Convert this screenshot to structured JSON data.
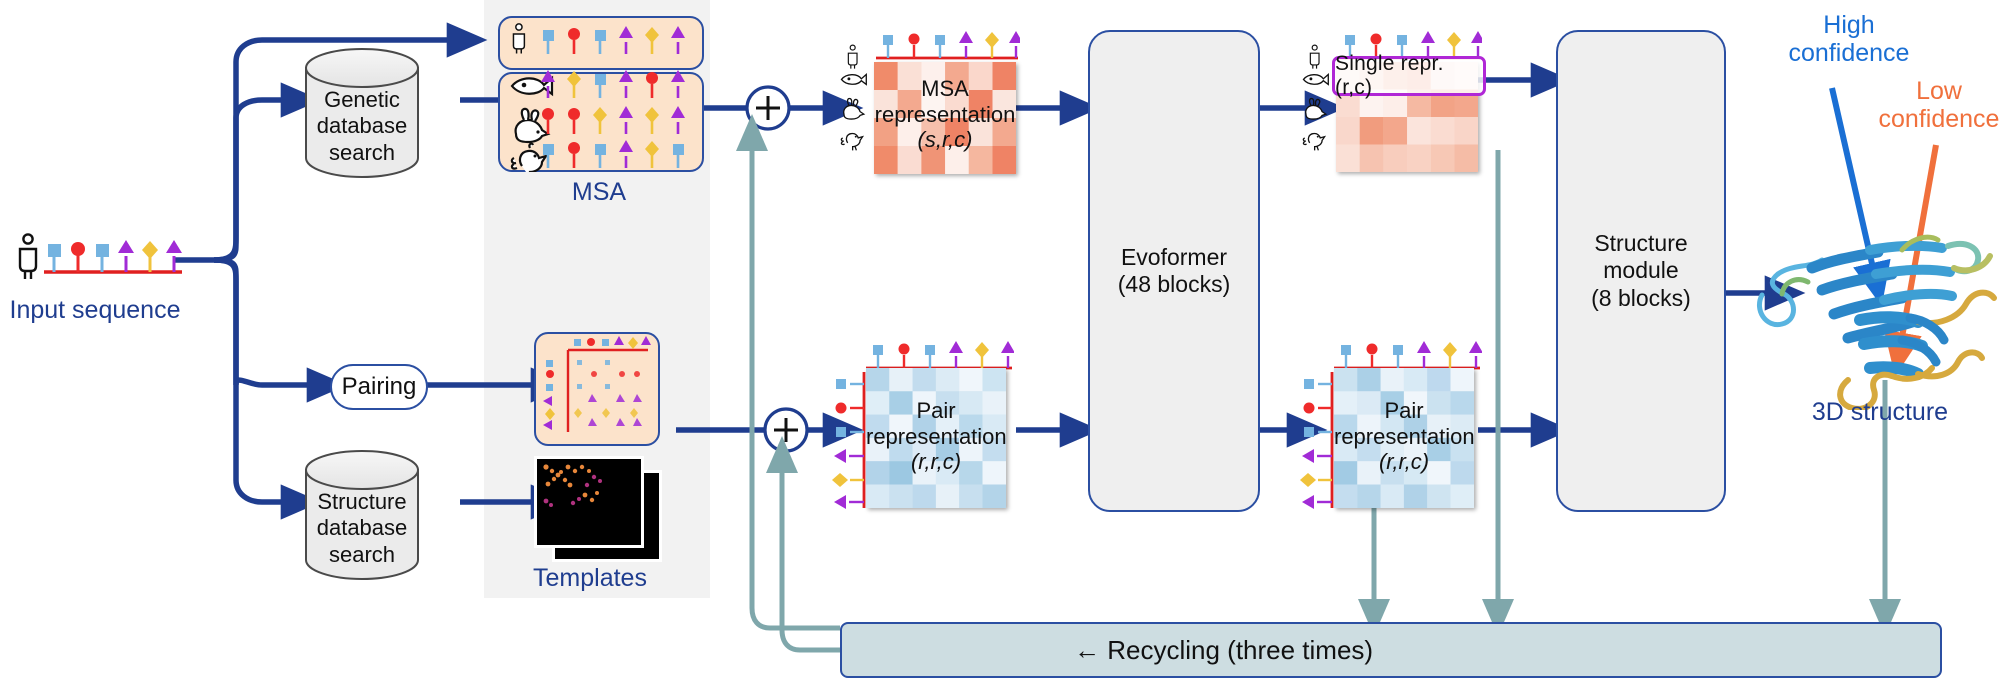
{
  "diagram": {
    "title": "AlphaFold 2 architecture",
    "colors": {
      "arrow_blue": "#1f3d8f",
      "label_blue": "#1f3d8f",
      "recycle_teal": "#7fa7ab",
      "msa_panel_bg": "#fce3cb",
      "group_border": "#2b4fa2",
      "grey_panel": "#f2f2f2",
      "block_fill": "#efefef",
      "highlight_purple": "#b027d6",
      "high_conf": "#1a6fd4",
      "low_conf": "#f0703c",
      "residue_blue": "#74b3e0",
      "residue_red": "#ef2b2b",
      "residue_purple": "#a12bd6",
      "residue_gold": "#f0c33c",
      "sequence_line": "#e02020"
    },
    "input": {
      "label": "Input sequence"
    },
    "searches": {
      "genetic": "Genetic\ndatabase\nsearch",
      "genetic_lines": [
        "Genetic",
        "database",
        "search"
      ],
      "structure_lines": [
        "Structure",
        "database",
        "search"
      ],
      "pairing": "Pairing"
    },
    "msa": {
      "label": "MSA"
    },
    "templates": {
      "label": "Templates"
    },
    "msa_representation": {
      "lines": [
        "MSA",
        "representation",
        "(s,r,c)"
      ]
    },
    "pair_representation": {
      "lines": [
        "Pair",
        "representation",
        "(r,r,c)"
      ]
    },
    "pair_representation_2": {
      "lines": [
        "Pair",
        "representation",
        "(r,r,c)"
      ]
    },
    "single_representation": {
      "label": "Single repr. (r,c)"
    },
    "evoformer": {
      "lines": [
        "Evoformer",
        "(48 blocks)"
      ]
    },
    "structure_module": {
      "lines": [
        "Structure",
        "module",
        "(8 blocks)"
      ]
    },
    "recycling": {
      "label": "← Recycling (three times)"
    },
    "output": {
      "label": "3D structure",
      "high_confidence": "High\nconfidence",
      "high_confidence_lines": [
        "High",
        "confidence"
      ],
      "low_confidence_lines": [
        "Low",
        "confidence"
      ]
    },
    "sequence_glyphs": [
      "square-blue",
      "circle-red",
      "square-blue",
      "arrow-purple",
      "diamond-gold",
      "arrow-purple"
    ],
    "msa_rows": [
      {
        "organism": "human-icon",
        "glyphs": [
          "square-blue",
          "circle-red",
          "square-blue",
          "arrow-purple",
          "diamond-gold",
          "arrow-purple"
        ]
      },
      {
        "organism": "fish-icon",
        "glyphs": [
          "arrow-purple",
          "diamond-gold",
          "square-blue",
          "arrow-purple",
          "circle-red",
          "arrow-purple"
        ]
      },
      {
        "organism": "rabbit-icon",
        "glyphs": [
          "circle-red",
          "circle-red",
          "diamond-gold",
          "arrow-purple",
          "diamond-gold",
          "arrow-purple"
        ]
      },
      {
        "organism": "chicken-icon",
        "glyphs": [
          "square-blue",
          "circle-red",
          "square-blue",
          "arrow-purple",
          "diamond-gold",
          "square-blue"
        ]
      }
    ],
    "msa_rep_rows": [
      "human-icon",
      "fish-icon",
      "rabbit-icon",
      "chicken-icon"
    ],
    "single_rep_rows": [
      "human-icon",
      "fish-icon",
      "rabbit-icon",
      "chicken-icon"
    ]
  },
  "chart_data": {
    "type": "heatmap",
    "title": "AlphaFold 2 network architecture",
    "panels": [
      {
        "name": "MSA representation (s,r,c)",
        "colormap": "reds",
        "cols": 6,
        "rows": 4,
        "values": [
          [
            0.55,
            0.3,
            0.15,
            0.45,
            0.25,
            0.5
          ],
          [
            0.2,
            0.45,
            0.12,
            0.3,
            0.55,
            0.18
          ],
          [
            0.42,
            0.18,
            0.35,
            0.55,
            0.2,
            0.4
          ],
          [
            0.5,
            0.22,
            0.48,
            0.15,
            0.38,
            0.55
          ]
        ]
      },
      {
        "name": "Single repr. (r,c)",
        "colormap": "reds",
        "cols": 6,
        "rows": 4,
        "values": [
          [
            0.18,
            0.3,
            0.45,
            0.52,
            0.22,
            0.16
          ],
          [
            0.22,
            0.1,
            0.14,
            0.4,
            0.48,
            0.46
          ],
          [
            0.26,
            0.52,
            0.46,
            0.18,
            0.22,
            0.24
          ],
          [
            0.2,
            0.34,
            0.28,
            0.25,
            0.3,
            0.35
          ]
        ]
      },
      {
        "name": "Pair representation (r,r,c)",
        "colormap": "blues",
        "cols": 6,
        "rows": 6,
        "values": [
          [
            0.42,
            0.18,
            0.38,
            0.22,
            0.1,
            0.3
          ],
          [
            0.2,
            0.46,
            0.14,
            0.34,
            0.26,
            0.16
          ],
          [
            0.35,
            0.12,
            0.44,
            0.18,
            0.4,
            0.24
          ],
          [
            0.16,
            0.38,
            0.22,
            0.48,
            0.14,
            0.36
          ],
          [
            0.46,
            0.52,
            0.18,
            0.26,
            0.42,
            0.12
          ],
          [
            0.22,
            0.3,
            0.4,
            0.16,
            0.34,
            0.44
          ]
        ]
      },
      {
        "name": "Pair representation (r,r,c) second",
        "colormap": "blues",
        "cols": 6,
        "rows": 6,
        "values": [
          [
            0.3,
            0.44,
            0.16,
            0.26,
            0.38,
            0.14
          ],
          [
            0.18,
            0.22,
            0.46,
            0.12,
            0.3,
            0.4
          ],
          [
            0.4,
            0.14,
            0.28,
            0.44,
            0.18,
            0.24
          ],
          [
            0.24,
            0.36,
            0.2,
            0.16,
            0.46,
            0.32
          ],
          [
            0.48,
            0.18,
            0.34,
            0.28,
            0.12,
            0.38
          ],
          [
            0.34,
            0.4,
            0.24,
            0.42,
            0.26,
            0.2
          ]
        ]
      }
    ]
  }
}
